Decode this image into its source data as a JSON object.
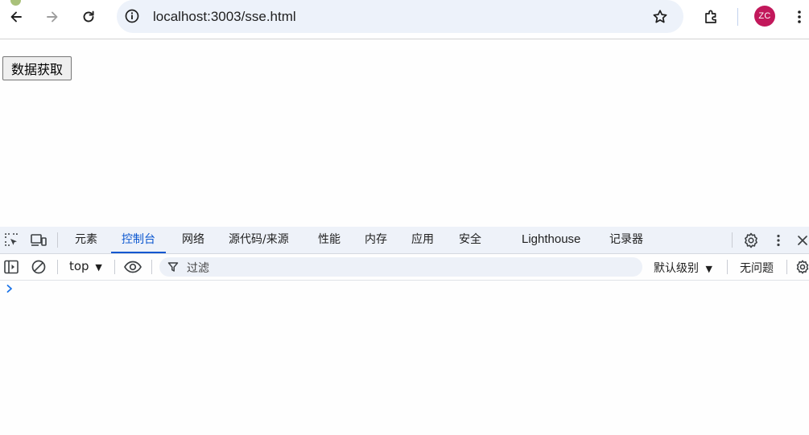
{
  "browser": {
    "url": "localhost:3003/sse.html",
    "profile_initials": "ZC",
    "colors": {
      "avatar": "#c2185b",
      "omnibox": "#edf2fa",
      "accent": "#0b57d0"
    },
    "icons": [
      "back-icon",
      "forward-icon",
      "reload-icon",
      "site-info-icon",
      "bookmark-star-icon",
      "extensions-icon",
      "more-menu-icon"
    ]
  },
  "page": {
    "button_label": "数据获取"
  },
  "devtools": {
    "tabs": [
      {
        "label": "元素"
      },
      {
        "label": "控制台",
        "active": true
      },
      {
        "label": "网络"
      },
      {
        "label": "源代码/来源"
      },
      {
        "label": "性能"
      },
      {
        "label": "内存"
      },
      {
        "label": "应用"
      },
      {
        "label": "安全"
      },
      {
        "label": "Lighthouse"
      },
      {
        "label": "记录器"
      }
    ],
    "console": {
      "context": "top",
      "filter_placeholder": "过滤",
      "levels_label": "默认级别",
      "issues_label": "无问题"
    }
  }
}
